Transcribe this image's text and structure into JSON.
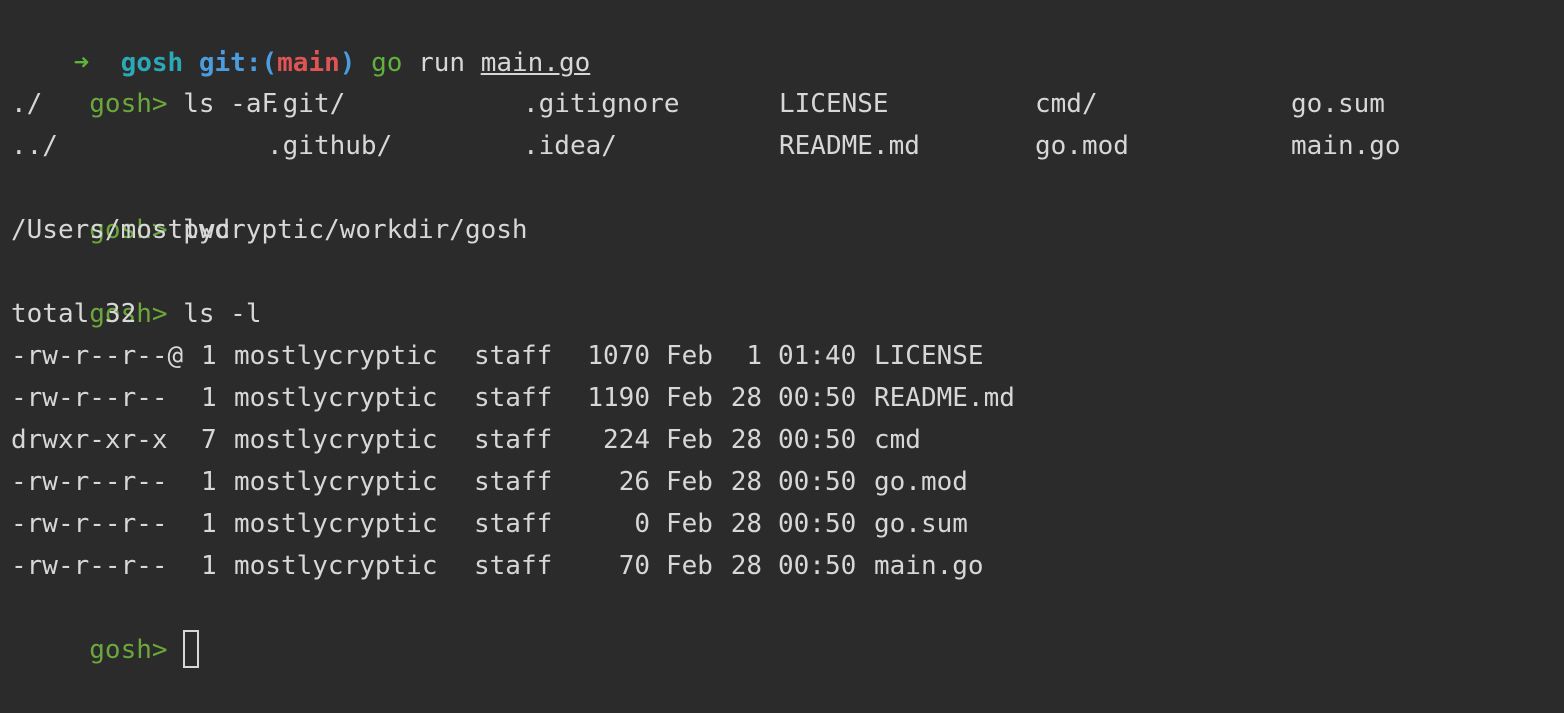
{
  "shell_prompt": {
    "arrow": "➜",
    "dir": "gosh",
    "git_label": "git:(",
    "branch": "main",
    "git_close": ")",
    "cmd_go": "go",
    "cmd_run": "run",
    "cmd_file": "main.go"
  },
  "gosh_prompt": "gosh>",
  "commands": {
    "ls_af": "ls -aF",
    "pwd": "pwd",
    "ls_l": "ls -l"
  },
  "ls_af_output": [
    [
      "./",
      ".git/",
      ".gitignore",
      "LICENSE",
      "cmd/",
      "go.sum"
    ],
    [
      "../",
      ".github/",
      ".idea/",
      "README.md",
      "go.mod",
      "main.go"
    ]
  ],
  "pwd_output": "/Users/mostlycryptic/workdir/gosh",
  "ls_l_total": "total 32",
  "ls_l_rows": [
    {
      "perms": "-rw-r--r--@",
      "links": "1",
      "owner": "mostlycryptic",
      "group": "staff",
      "size": "1070",
      "month": "Feb",
      "day": "1",
      "time": "01:40",
      "name": "LICENSE"
    },
    {
      "perms": "-rw-r--r--",
      "links": "1",
      "owner": "mostlycryptic",
      "group": "staff",
      "size": "1190",
      "month": "Feb",
      "day": "28",
      "time": "00:50",
      "name": "README.md"
    },
    {
      "perms": "drwxr-xr-x",
      "links": "7",
      "owner": "mostlycryptic",
      "group": "staff",
      "size": "224",
      "month": "Feb",
      "day": "28",
      "time": "00:50",
      "name": "cmd"
    },
    {
      "perms": "-rw-r--r--",
      "links": "1",
      "owner": "mostlycryptic",
      "group": "staff",
      "size": "26",
      "month": "Feb",
      "day": "28",
      "time": "00:50",
      "name": "go.mod"
    },
    {
      "perms": "-rw-r--r--",
      "links": "1",
      "owner": "mostlycryptic",
      "group": "staff",
      "size": "0",
      "month": "Feb",
      "day": "28",
      "time": "00:50",
      "name": "go.sum"
    },
    {
      "perms": "-rw-r--r--",
      "links": "1",
      "owner": "mostlycryptic",
      "group": "staff",
      "size": "70",
      "month": "Feb",
      "day": "28",
      "time": "00:50",
      "name": "main.go"
    }
  ],
  "colors": {
    "background": "#2b2b2b",
    "text": "#d7d7d7",
    "prompt_green": "#6aa83c",
    "arrow_green": "#5fb23c",
    "dir_cyan": "#2aa9b6",
    "git_blue": "#4b9de0",
    "branch_red": "#e05454"
  }
}
